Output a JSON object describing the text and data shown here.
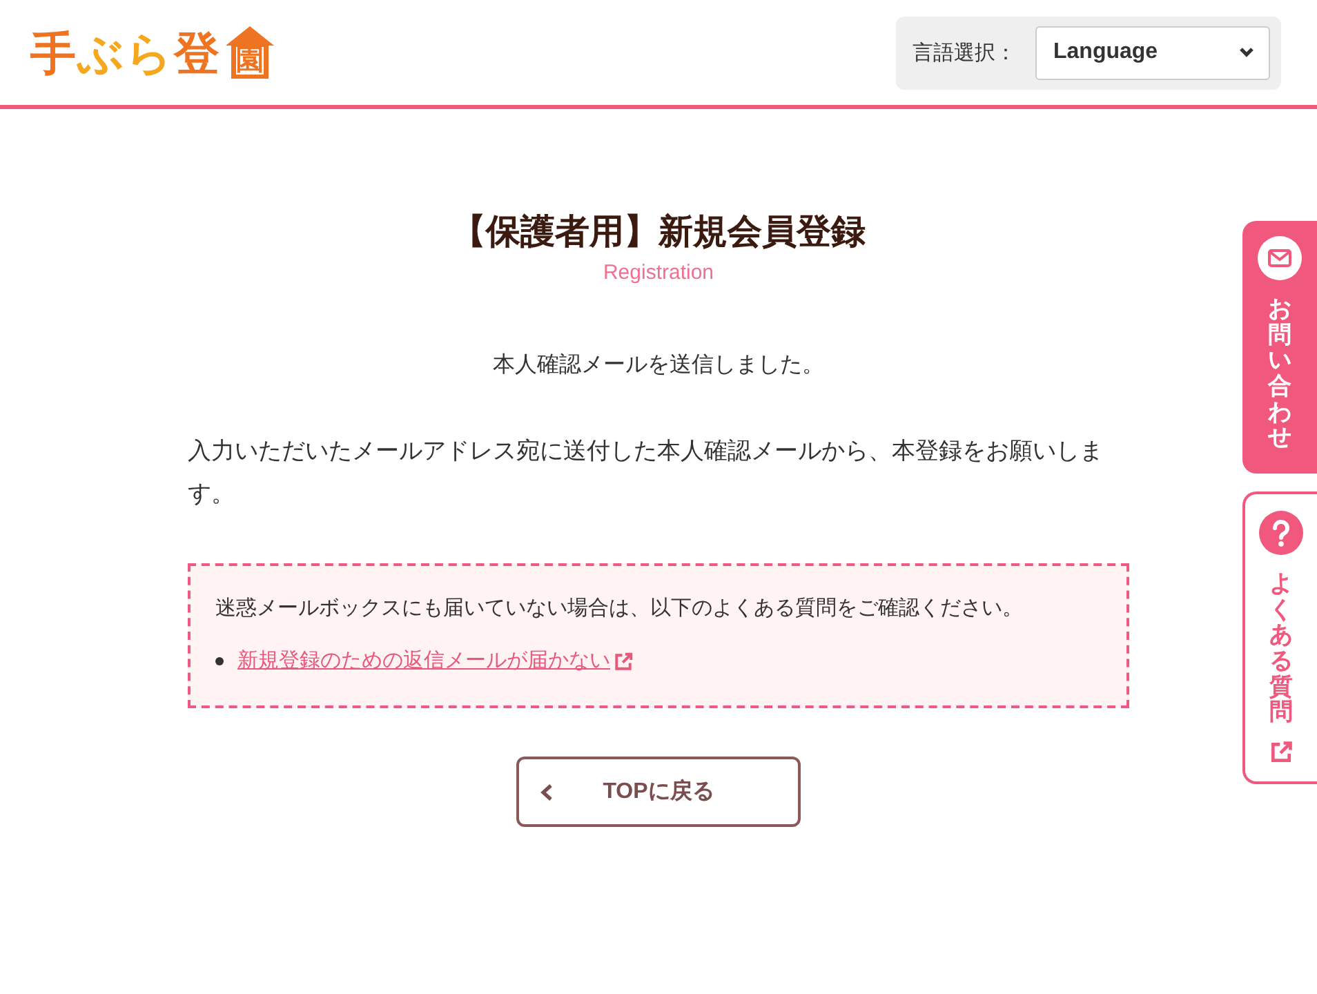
{
  "header": {
    "logo": {
      "text": "手**ぶら**登",
      "house_char": "園"
    },
    "language": {
      "label": "言語選択：",
      "value": "Language"
    }
  },
  "page": {
    "title": "【保護者用】新規会員登録",
    "subtitle": "Registration",
    "status_message": "本人確認メールを送信しました。",
    "instruction": "入力いただいたメールアドレス宛に送付した本人確認メールから、本登録をお願いします。",
    "notice": {
      "text": "迷惑メールボックスにも届いていない場合は、以下のよくある質問をご確認ください。",
      "links": [
        {
          "text": "新規登録のための返信メールが届かない",
          "external": true
        }
      ]
    },
    "back_button": {
      "label": "TOPに戻る"
    }
  },
  "side_tabs": [
    {
      "kind": "contact",
      "label": "お問い合わせ",
      "external": false
    },
    {
      "kind": "faq",
      "label": "よくある質問",
      "external": true
    }
  ]
}
